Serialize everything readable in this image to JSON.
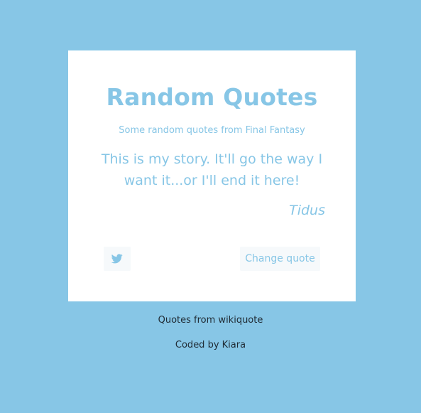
{
  "card": {
    "title": "Random Quotes",
    "subtitle": "Some random quotes from Final Fantasy",
    "quote": "This is my story. It'll go the way I want it...or I'll end it here!",
    "author": "Tidus"
  },
  "buttons": {
    "tweet_icon": "twitter-icon",
    "change_quote_label": "Change quote"
  },
  "footer": {
    "source": "Quotes from wikiquote",
    "credit": "Coded by Kiara"
  },
  "colors": {
    "background": "#87c6e6",
    "card": "#ffffff",
    "accent": "#87c6e6",
    "button_bg": "#f6f9fb",
    "footer_text": "#1f2a33"
  }
}
